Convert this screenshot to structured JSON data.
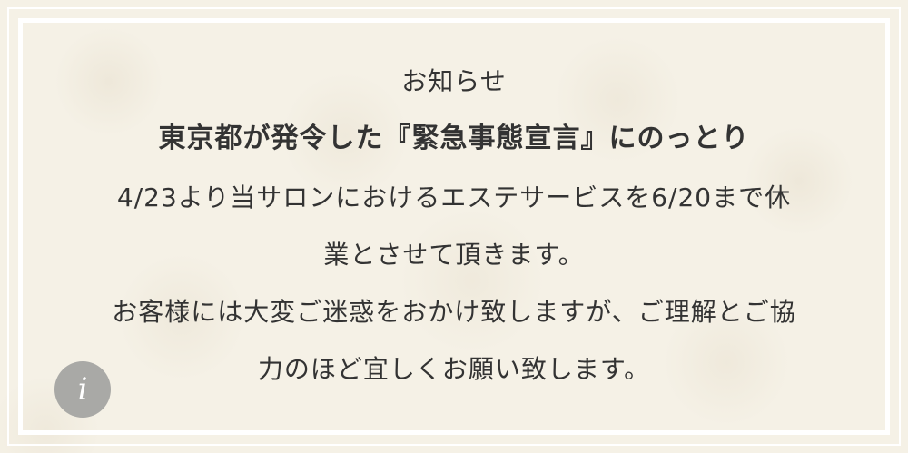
{
  "notice": {
    "title": "お知らせ",
    "subtitle": "東京都が発令した『緊急事態宣言』にのっとり",
    "line1": "4/23より当サロンにおけるエステサービスを6/20まで休",
    "line2": "業とさせて頂きます。",
    "line3": "お客様には大変ご迷惑をおかけ致しますが、ご理解とご協",
    "line4": "力のほど宜しくお願い致します。"
  },
  "info_button": {
    "icon": "info-icon",
    "glyph": "i"
  },
  "colors": {
    "background": "#f5f1e6",
    "frame": "#ffffff",
    "text": "#333333",
    "info_button": "#a9a9a6"
  }
}
